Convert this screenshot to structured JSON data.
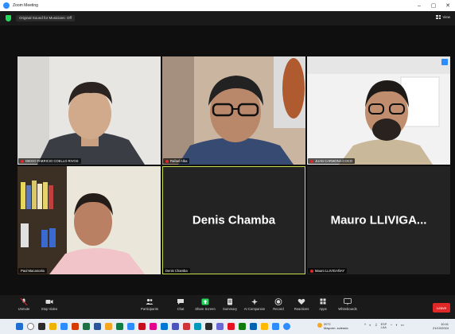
{
  "window": {
    "title": "Zoom Meeting",
    "minimize": "–",
    "maximize": "▢",
    "close": "✕"
  },
  "topbar": {
    "original_sound": "Original Sound for Musicians: Off",
    "view_label": "View"
  },
  "tiles": [
    {
      "name": "DIEGO FABRICIO COELLO RIVOS",
      "muted": true,
      "video": true
    },
    {
      "name": "Rafael Alba",
      "muted": true,
      "video": true
    },
    {
      "name": "JUAN CARMONA COCO",
      "muted": true,
      "video": true
    },
    {
      "name": "Paul Macancela",
      "muted": false,
      "video": true
    },
    {
      "name": "Denis Chamba",
      "display_name": "Denis Chamba",
      "muted": false,
      "video": false,
      "active_speaker": true
    },
    {
      "name": "Mauro LLIVIGAÑAY",
      "display_name": "Mauro  LLIVIGA...",
      "muted": true,
      "video": false
    }
  ],
  "toolbar": {
    "unmute": "Unmute",
    "stop_video": "Stop Video",
    "participants": "Participants",
    "participants_count": "6",
    "chat": "Chat",
    "share_screen": "Share Screen",
    "summary": "Summary",
    "ai_companion": "AI Companion",
    "record": "Record",
    "reactions": "Reactions",
    "apps": "Apps",
    "whiteboards": "Whiteboards",
    "leave": "Leave"
  },
  "taskbar": {
    "weather_temp": "20°C",
    "weather_desc": "Mayorm. soleado",
    "lang_top": "ESP",
    "lang_bottom": "LAA",
    "time": "10:41",
    "date": "21/10/2024"
  },
  "colors": {
    "accent": "#2d8cff",
    "active_border": "#c8e04a",
    "leave": "#e02828",
    "share": "#23d959"
  }
}
